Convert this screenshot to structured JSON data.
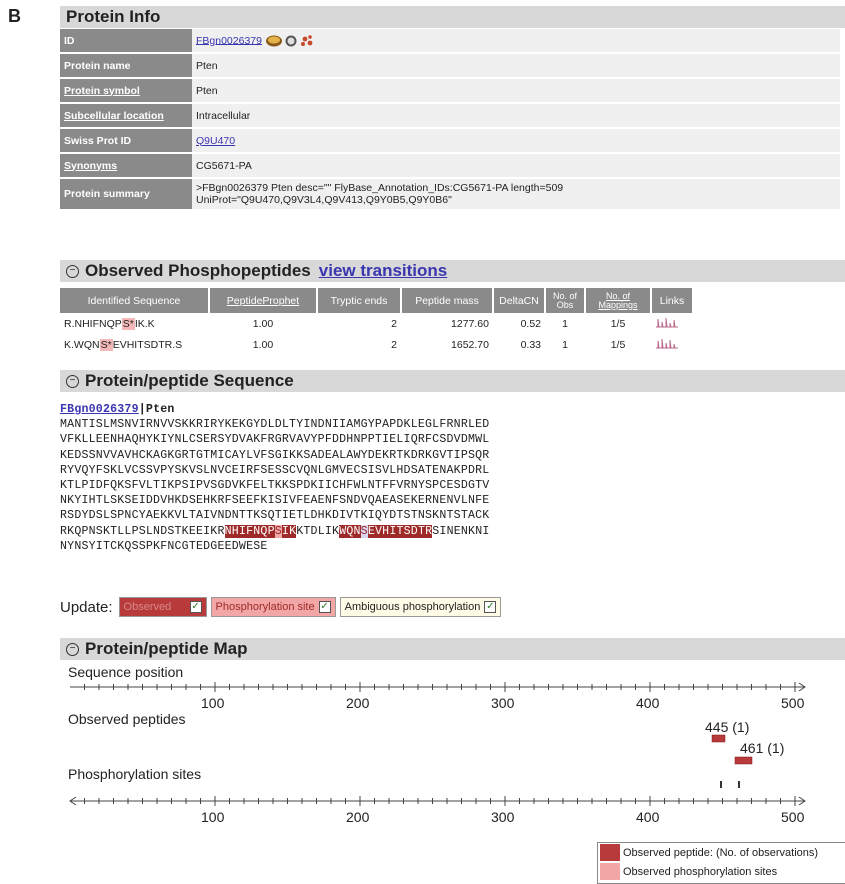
{
  "panel_letter": "B",
  "protein_info": {
    "header": "Protein Info",
    "rows": [
      {
        "label": "ID",
        "value": "FBgn0026379"
      },
      {
        "label": "Protein name",
        "value": "Pten"
      },
      {
        "label": "Protein symbol",
        "value": "Pten"
      },
      {
        "label": "Subcellular location",
        "value": "Intracellular"
      },
      {
        "label": "Swiss Prot ID",
        "value": "Q9U470"
      },
      {
        "label": "Synonyms",
        "value": "CG5671-PA"
      },
      {
        "label": "Protein summary",
        "value_line1": ">FBgn0026379 Pten desc=\"\" FlyBase_Annotation_IDs:CG5671-PA length=509",
        "value_line2": "UniProt=\"Q9U470,Q9V3L4,Q9V413,Q9Y0B5,Q9Y0B6\""
      }
    ]
  },
  "phospho": {
    "header": "Observed Phosphopeptides",
    "link": "view transitions",
    "columns": [
      "Identified Sequence",
      "PeptideProphet",
      "Tryptic ends",
      "Peptide mass",
      "DeltaCN",
      "No. of Obs",
      "No. of Mappings",
      "Links"
    ],
    "rows": [
      {
        "pre": "R.NHIFNQP",
        "site": "S*",
        "post": "IK.K",
        "prophet": "1.00",
        "tryptic": "2",
        "mass": "1277.60",
        "deltacn": "0.52",
        "obs": "1",
        "mappings": "1/5"
      },
      {
        "pre": "K.WQN",
        "site": "S*",
        "post": "EVHITSDTR.S",
        "prophet": "1.00",
        "tryptic": "2",
        "mass": "1652.70",
        "deltacn": "0.33",
        "obs": "1",
        "mappings": "1/5"
      }
    ]
  },
  "sequence": {
    "header": "Protein/peptide Sequence",
    "id": "FBgn0026379",
    "name": "Pten",
    "lines": [
      "MANTISLMSNVIRNVVSKKRIRYKEKGYDLDLTYINDNIIAMGYPAPDKLEGLFRNRLED",
      "VFKLLEENHAQHYKIYNLCSERSYDVAKFRGRVAVYPFDDHNPPTIELIQRFCSDVDMWL",
      "KEDSSNVVAVHCKAGKGRTGTMICAYLVFSGIKKSADEALAWYDEKRTKDRKGVTIPSQR",
      "RYVQYFSKLVCSSVPYSKVSLNVCEIRFSESSCVQNLGMVECSISVLHDSATENAKPDRL",
      "KTLPIDFQKSFVLTIKPSIPVSGDVKFELTKKSPDKIICHFWLNTFFVRNYSPCESDGTV",
      "NKYIHTLSKSEIDDVHKDSEHKRFSEEFKISIVFEAENFSNDVQAEASEKERNENVLNFE",
      "RSDYDSLSPNCYAEKKVLTAIVNDNTTKSQTIETLDHKDIVTKIQYDTSTNSKNTSTACK"
    ],
    "line8_a": "RKQPNSKTLLPSLNDSTKEEIKR",
    "line8_pep1a": "NHIFNQP",
    "line8_pep1s": "S",
    "line8_pep1b": "IK",
    "line8_mid": "KTDLIK",
    "line8_pep2a": "WQN",
    "line8_pep2s": "S",
    "line8_pep2b": "EVHITSDTR",
    "line8_end": "SINENKNI",
    "line9": "NYNSYITCKQSSPKFNCGTEDGEEDWESE"
  },
  "update": {
    "label": "Update:",
    "observed": "Observed",
    "phospho_site": "Phosphorylation site",
    "ambiguous": "Ambiguous phosphorylation"
  },
  "map": {
    "header": "Protein/peptide Map",
    "seq_pos_label": "Sequence position",
    "observed_label": "Observed peptides",
    "phos_label": "Phosphorylation sites",
    "ticks": [
      "100",
      "200",
      "300",
      "400",
      "500"
    ],
    "peptide1": "445 (1)",
    "peptide2": "461 (1)",
    "legend_observed": "Observed peptide: (No. of observations)",
    "legend_phos": "Observed phosphorylation sites"
  },
  "colors": {
    "observed": "#b83a3a",
    "phospho": "#f2a6a6",
    "ambiguous": "#d7d7f2"
  }
}
